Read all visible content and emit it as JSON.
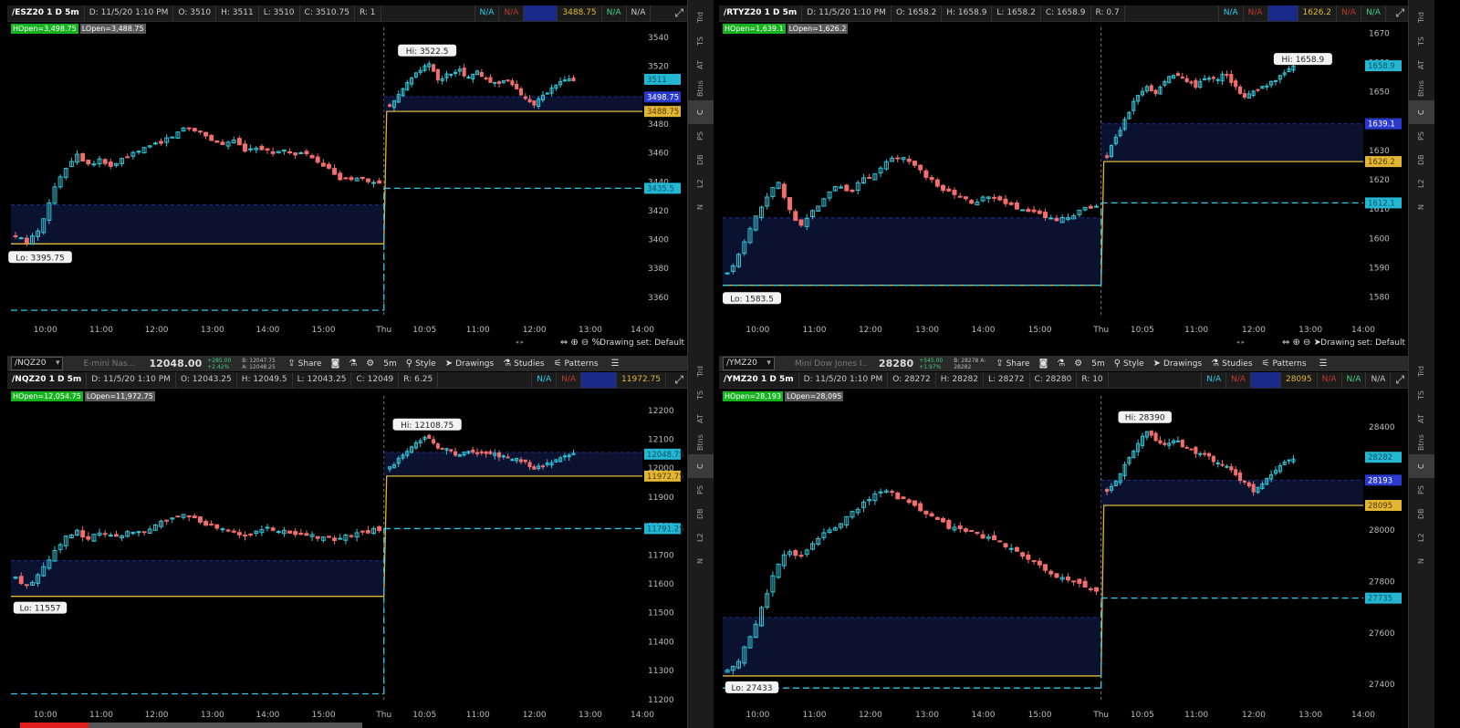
{
  "status_bar": {
    "drawing_set": "Drawing set: Default"
  },
  "side_tabs": [
    "Trd",
    "TS",
    "AT",
    "Btns",
    "C",
    "PS",
    "DB",
    "L2",
    "N"
  ],
  "toolbar": {
    "share": "Share",
    "interval": "5m",
    "style": "Style",
    "drawings": "Drawings",
    "studies": "Studies",
    "patterns": "Patterns"
  },
  "colors": {
    "up": "#33c6d9",
    "down": "#f26d6d",
    "yellow_level": "#e2b634",
    "cyan_level": "#2ec9e6",
    "zone_fill": "#0a1230",
    "zone_dash": "#1e2f8a"
  },
  "charts": [
    {
      "header": {
        "sym": "/ESZ20 1 D 5m",
        "date": "D: 11/5/20 1:10 PM",
        "o": "O: 3510",
        "h": "H: 3511",
        "l": "L: 3510",
        "c": "C: 3510.75",
        "r": "R: 1",
        "na": "N/A",
        "val": "3488.75"
      },
      "hopen": "HOpen=3,498.75",
      "lopen": "LOpen=3,488.75",
      "hi_label": "Hi: 3522.5",
      "lo_label": "Lo: 3395.75",
      "y_ticks": [
        "3540",
        "3520",
        "3500",
        "3480",
        "3460",
        "3440",
        "3420",
        "3400",
        "3380",
        "3360"
      ],
      "price_tags": {
        "cyan_top": "3511",
        "blue": "3498.75",
        "yellow": "3488.75",
        "cyan_mid": "3435.5"
      },
      "x_ticks": [
        "10:00",
        "11:00",
        "12:00",
        "13:00",
        "14:00",
        "15:00",
        "Thu",
        "10:05",
        "11:00",
        "12:00",
        "13:00",
        "14:00"
      ],
      "chart_data": {
        "type": "candlestick",
        "ylim": [
          3346,
          3547
        ],
        "y_axis_ticks": [
          3540,
          3520,
          3500,
          3480,
          3460,
          3440,
          3420,
          3400,
          3380,
          3360
        ],
        "x_axis_ticks": [
          "10:00",
          "11:00",
          "12:00",
          "13:00",
          "14:00",
          "15:00",
          "Thu",
          "10:05",
          "11:00",
          "12:00",
          "13:00",
          "14:00"
        ],
        "day1_series": [
          3402,
          3398,
          3408,
          3432,
          3448,
          3460,
          3452,
          3455,
          3450,
          3457,
          3460,
          3465,
          3468,
          3472,
          3478,
          3476,
          3470,
          3466,
          3468,
          3462,
          3465,
          3460,
          3462,
          3458,
          3460,
          3452,
          3448,
          3440,
          3444,
          3440,
          3438
        ],
        "day2_series": [
          3492,
          3500,
          3510,
          3516,
          3522.5,
          3510,
          3514,
          3518,
          3513,
          3516,
          3510,
          3508,
          3512,
          3504,
          3498,
          3494,
          3500,
          3506,
          3510,
          3511
        ],
        "hi": 3522.5,
        "lo": 3395.75,
        "zone_day1": [
          3397,
          3424
        ],
        "zone_day2": [
          3488.75,
          3499
        ],
        "hopen": 3498.75,
        "lopen": 3488.75,
        "prior_day_dash": 3435.5,
        "low_dash": 3351,
        "last": 3511
      }
    },
    {
      "header": {
        "sym": "/RTYZ20 1 D 5m",
        "date": "D: 11/5/20 1:10 PM",
        "o": "O: 1658.2",
        "h": "H: 1658.9",
        "l": "L: 1658.2",
        "c": "C: 1658.9",
        "r": "R: 0.7",
        "na": "N/A",
        "val": "1626.2"
      },
      "hopen": "HOpen=1,639.1",
      "lopen": "LOpen=1,626.2",
      "hi_label": "Hi: 1658.9",
      "lo_label": "Lo: 1583.5",
      "y_ticks": [
        "1670",
        "1660",
        "1650",
        "1640",
        "1630",
        "1620",
        "1610",
        "1600",
        "1590",
        "1580"
      ],
      "price_tags": {
        "cyan_top": "1658.9",
        "blue": "1639.1",
        "yellow": "1626.2",
        "cyan_mid": "1612.1"
      },
      "x_ticks": [
        "10:00",
        "11:00",
        "12:00",
        "13:00",
        "14:00",
        "15:00",
        "Thu",
        "10:05",
        "11:00",
        "12:00",
        "13:00",
        "14:00"
      ],
      "chart_data": {
        "type": "candlestick",
        "ylim": [
          1573,
          1672
        ],
        "y_axis_ticks": [
          1670,
          1660,
          1650,
          1640,
          1630,
          1620,
          1610,
          1600,
          1590,
          1580
        ],
        "x_axis_ticks": [
          "10:00",
          "11:00",
          "12:00",
          "13:00",
          "14:00",
          "15:00",
          "Thu",
          "10:05",
          "11:00",
          "12:00",
          "13:00",
          "14:00"
        ],
        "day1_series": [
          1588,
          1595,
          1605,
          1612,
          1620,
          1610,
          1604,
          1610,
          1614,
          1618,
          1616,
          1620,
          1622,
          1626,
          1628,
          1625,
          1622,
          1618,
          1616,
          1614,
          1612,
          1614,
          1613,
          1611,
          1610,
          1609,
          1607,
          1606,
          1608,
          1610,
          1611
        ],
        "day2_series": [
          1628,
          1635,
          1642,
          1648,
          1652,
          1650,
          1654,
          1656,
          1654,
          1652,
          1655,
          1654,
          1656,
          1652,
          1648,
          1650,
          1652,
          1654,
          1656,
          1658.9
        ],
        "hi": 1658.9,
        "lo": 1583.5,
        "zone_day1": [
          1584,
          1607
        ],
        "zone_day2": [
          1626.2,
          1639.1
        ],
        "hopen": 1639.1,
        "lopen": 1626.2,
        "prior_day_dash": 1612.1,
        "low_dash": 1584,
        "last": 1658.9
      }
    },
    {
      "toolbar": {
        "symbol": "/NQZ20",
        "desc": "E-mini Nas...",
        "price": "12048.00",
        "change": "+285.00 +2.42%",
        "bid": "B: 12047.75",
        "ask": "A: 12048.25"
      },
      "header": {
        "sym": "/NQZ20 1 D 5m",
        "date": "D: 11/5/20 1:10 PM",
        "o": "O: 12043.25",
        "h": "H: 12049.5",
        "l": "L: 12043.25",
        "c": "C: 12049",
        "r": "R: 6.25",
        "na": "N/A",
        "val": "11972.75"
      },
      "hopen": "HOpen=12,054.75",
      "lopen": "LOpen=11,972.75",
      "hi_label": "Hi: 12108.75",
      "lo_label": "Lo: 11557",
      "y_ticks": [
        "12200",
        "12100",
        "12000",
        "11900",
        "11800",
        "11700",
        "11600",
        "11500",
        "11400",
        "11300",
        "11200"
      ],
      "price_tags": {
        "cyan_top": "12048.75",
        "yellow": "11972.75",
        "cyan_mid": "11791.25"
      },
      "x_ticks": [
        "10:00",
        "11:00",
        "12:00",
        "13:00",
        "14:00",
        "15:00",
        "Thu",
        "10:05",
        "11:00",
        "12:00",
        "13:00",
        "14:00"
      ],
      "chart_data": {
        "type": "candlestick",
        "ylim": [
          11190,
          12250
        ],
        "y_axis_ticks": [
          12200,
          12100,
          12000,
          11900,
          11800,
          11700,
          11600,
          11500,
          11400,
          11300,
          11200
        ],
        "x_axis_ticks": [
          "10:00",
          "11:00",
          "12:00",
          "13:00",
          "14:00",
          "15:00",
          "Thu",
          "10:05",
          "11:00",
          "12:00",
          "13:00",
          "14:00"
        ],
        "day1_series": [
          11620,
          11590,
          11640,
          11700,
          11760,
          11780,
          11760,
          11770,
          11765,
          11775,
          11780,
          11790,
          11810,
          11830,
          11840,
          11820,
          11800,
          11790,
          11780,
          11770,
          11785,
          11790,
          11780,
          11775,
          11770,
          11760,
          11755,
          11760,
          11770,
          11780,
          11791
        ],
        "day2_series": [
          12000,
          12040,
          12070,
          12090,
          12108.75,
          12070,
          12060,
          12050,
          12060,
          12055,
          12050,
          12045,
          12040,
          12035,
          12020,
          11995,
          12010,
          12025,
          12040,
          12048
        ],
        "hi": 12108.75,
        "lo": 11557,
        "zone_day1": [
          11557,
          11680
        ],
        "zone_day2": [
          11972.75,
          12054.75
        ],
        "hopen": 12054.75,
        "lopen": 11972.75,
        "prior_day_dash": 11791.25,
        "low_dash": 11220,
        "last": 12048.75
      }
    },
    {
      "toolbar": {
        "symbol": "/YMZ20",
        "desc": "Mini Dow Jones I...",
        "price": "28280",
        "change": "+545.00 +1.97%",
        "bid": "B: 28278",
        "ask": "A: 28282"
      },
      "header": {
        "sym": "/YMZ20 1 D 5m",
        "date": "D: 11/5/20 1:10 PM",
        "o": "O: 28272",
        "h": "H: 28282",
        "l": "L: 28272",
        "c": "C: 28280",
        "r": "R: 10",
        "na": "N/A",
        "val": "28095"
      },
      "hopen": "HOpen=28,193",
      "lopen": "LOpen=28,095",
      "hi_label": "Hi: 28390",
      "lo_label": "Lo: 27433",
      "y_ticks": [
        "28400",
        "28200",
        "28000",
        "27800",
        "27600",
        "27400"
      ],
      "price_tags": {
        "cyan_top": "28282",
        "blue": "28193",
        "yellow": "28095",
        "cyan_mid": "27735"
      },
      "x_ticks": [
        "10:00",
        "11:00",
        "12:00",
        "13:00",
        "14:00",
        "15:00",
        "Thu",
        "10:05",
        "11:00",
        "12:00",
        "13:00",
        "14:00"
      ],
      "chart_data": {
        "type": "candlestick",
        "ylim": [
          27330,
          28520
        ],
        "y_axis_ticks": [
          28400,
          28200,
          28000,
          27800,
          27600,
          27400
        ],
        "x_axis_ticks": [
          "10:00",
          "11:00",
          "12:00",
          "13:00",
          "14:00",
          "15:00",
          "Thu",
          "10:05",
          "11:00",
          "12:00",
          "13:00",
          "14:00"
        ],
        "day1_series": [
          27450,
          27500,
          27600,
          27720,
          27860,
          27920,
          27900,
          27950,
          27990,
          28020,
          28060,
          28100,
          28140,
          28160,
          28120,
          28100,
          28060,
          28040,
          28010,
          28000,
          27990,
          27970,
          27950,
          27930,
          27900,
          27870,
          27840,
          27810,
          27800,
          27780,
          27760
        ],
        "day2_series": [
          28150,
          28200,
          28260,
          28320,
          28390,
          28340,
          28330,
          28350,
          28320,
          28300,
          28290,
          28270,
          28250,
          28220,
          28180,
          28150,
          28190,
          28230,
          28260,
          28282
        ],
        "hi": 28390,
        "lo": 27433,
        "zone_day1": [
          27433,
          27660
        ],
        "zone_day2": [
          28095,
          28193
        ],
        "hopen": 28193,
        "lopen": 28095,
        "prior_day_dash": 27735,
        "low_dash": 27386,
        "last": 28282
      }
    }
  ]
}
